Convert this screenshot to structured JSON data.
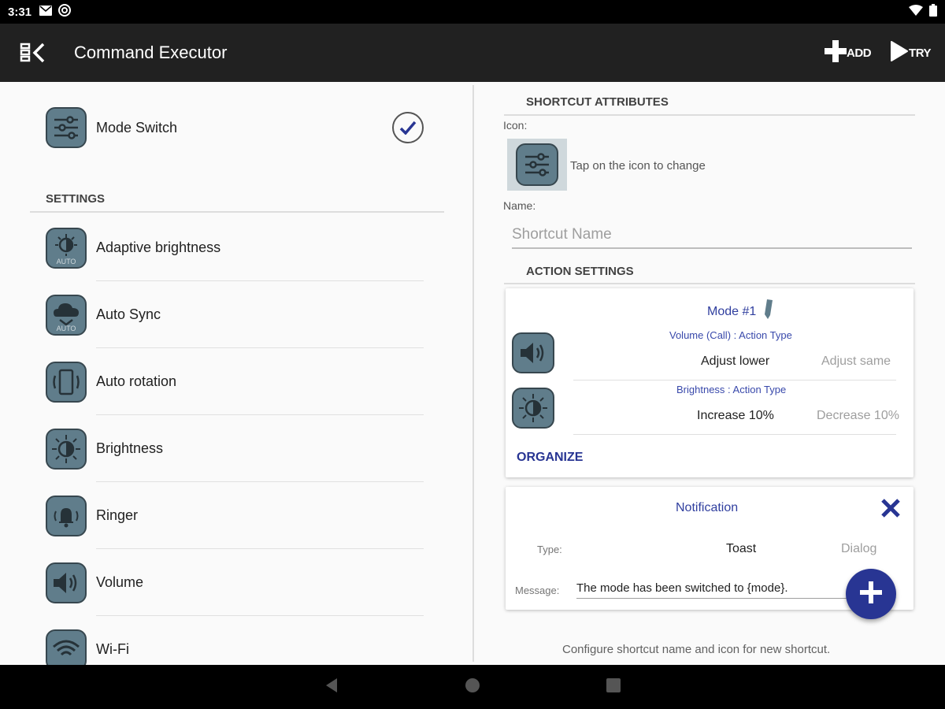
{
  "status_bar": {
    "time": "3:31",
    "icons_left": [
      "mail-icon",
      "at-icon"
    ],
    "icons_right": [
      "wifi-icon",
      "battery-icon"
    ]
  },
  "app_bar": {
    "title": "Command Executor",
    "back_icon": "drawer-back-icon",
    "add_label": "ADD",
    "try_label": "TRY"
  },
  "left": {
    "mode_switch_label": "Mode Switch",
    "settings_header": "SETTINGS",
    "settings_items": [
      {
        "label": "Adaptive brightness",
        "icon": "adaptive-brightness-icon"
      },
      {
        "label": "Auto Sync",
        "icon": "auto-sync-icon"
      },
      {
        "label": "Auto rotation",
        "icon": "auto-rotation-icon"
      },
      {
        "label": "Brightness",
        "icon": "brightness-icon"
      },
      {
        "label": "Ringer",
        "icon": "ringer-icon"
      },
      {
        "label": "Volume",
        "icon": "volume-icon"
      },
      {
        "label": "Wi-Fi",
        "icon": "wifi-icon"
      }
    ],
    "auto_badge": "AUTO"
  },
  "right": {
    "shortcut_attributes_header": "SHORTCUT ATTRIBUTES",
    "icon_label": "Icon:",
    "icon_hint": "Tap on the icon to change",
    "name_label": "Name:",
    "name_placeholder": "Shortcut Name",
    "action_settings_header": "ACTION SETTINGS",
    "mode_card": {
      "title": "Mode #1",
      "volume_type": "Volume (Call) : Action Type",
      "volume_selected": "Adjust lower",
      "volume_other": "Adjust same",
      "brightness_type": "Brightness : Action Type",
      "brightness_selected": "Increase 10%",
      "brightness_other": "Decrease 10%",
      "organize": "ORGANIZE"
    },
    "notification_card": {
      "title": "Notification",
      "type_label": "Type:",
      "type_selected": "Toast",
      "type_other": "Dialog",
      "message_label": "Message:",
      "message_value": "The mode has been switched to {mode}."
    },
    "footer_hint": "Configure shortcut name and icon for new shortcut."
  },
  "colors": {
    "accent": "#283593",
    "tile": "#607d8b",
    "app_bar": "#212121"
  }
}
